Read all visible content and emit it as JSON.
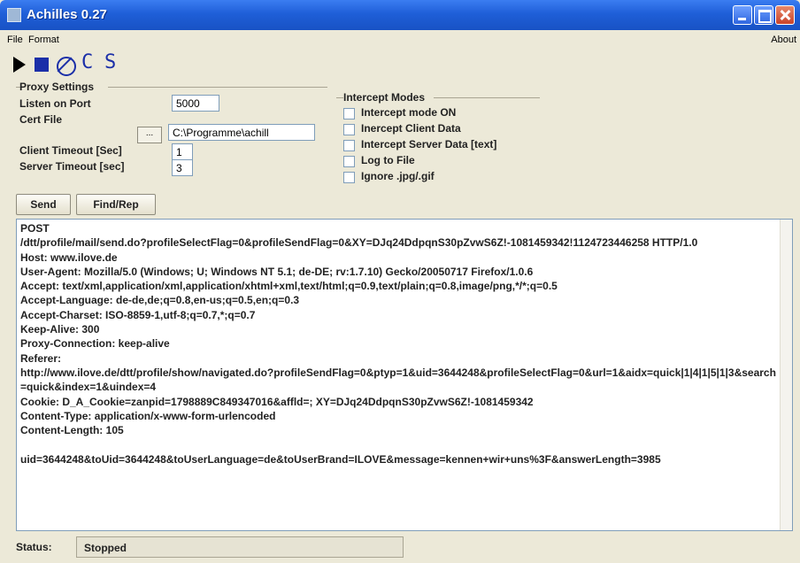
{
  "window": {
    "title": "Achilles 0.27"
  },
  "menu": {
    "file": "File",
    "format": "Format",
    "about": "About"
  },
  "toolbar": {
    "c_label": "C",
    "s_label": "S"
  },
  "proxy": {
    "group_title": "Proxy Settings",
    "listen_port_label": "Listen on Port",
    "listen_port_value": "5000",
    "cert_file_label": "Cert File",
    "cert_browse_label": "...",
    "cert_file_value": "C:\\Programme\\achill",
    "client_timeout_label": "Client Timeout [Sec]",
    "client_timeout_value": "1",
    "server_timeout_label": "Server Timeout [sec]",
    "server_timeout_value": "3"
  },
  "intercept": {
    "group_title": "Intercept Modes",
    "options": [
      {
        "label": "Intercept mode ON",
        "checked": false
      },
      {
        "label": "Inercept Client Data",
        "checked": false
      },
      {
        "label": "Intercept Server Data [text]",
        "checked": false
      },
      {
        "label": "Log to File",
        "checked": false
      },
      {
        "label": "Ignore .jpg/.gif",
        "checked": false
      }
    ]
  },
  "actions": {
    "send_label": "Send",
    "find_label": "Find/Rep"
  },
  "request_text": "POST\n/dtt/profile/mail/send.do?profileSelectFlag=0&profileSendFlag=0&XY=DJq24DdpqnS30pZvwS6Z!-1081459342!1124723446258 HTTP/1.0\nHost: www.ilove.de\nUser-Agent: Mozilla/5.0 (Windows; U; Windows NT 5.1; de-DE; rv:1.7.10) Gecko/20050717 Firefox/1.0.6\nAccept: text/xml,application/xml,application/xhtml+xml,text/html;q=0.9,text/plain;q=0.8,image/png,*/*;q=0.5\nAccept-Language: de-de,de;q=0.8,en-us;q=0.5,en;q=0.3\nAccept-Charset: ISO-8859-1,utf-8;q=0.7,*;q=0.7\nKeep-Alive: 300\nProxy-Connection: keep-alive\nReferer:\nhttp://www.ilove.de/dtt/profile/show/navigated.do?profileSendFlag=0&ptyp=1&uid=3644248&profileSelectFlag=0&url=1&aidx=quick|1|4|1|5|1|3&search=quick&index=1&uindex=4\nCookie: D_A_Cookie=zanpid=1798889C849347016&affld=; XY=DJq24DdpqnS30pZvwS6Z!-1081459342\nContent-Type: application/x-www-form-urlencoded\nContent-Length: 105\n\nuid=3644248&toUid=3644248&toUserLanguage=de&toUserBrand=ILOVE&message=kennen+wir+uns%3F&answerLength=3985",
  "status": {
    "label": "Status:",
    "value": "Stopped"
  }
}
